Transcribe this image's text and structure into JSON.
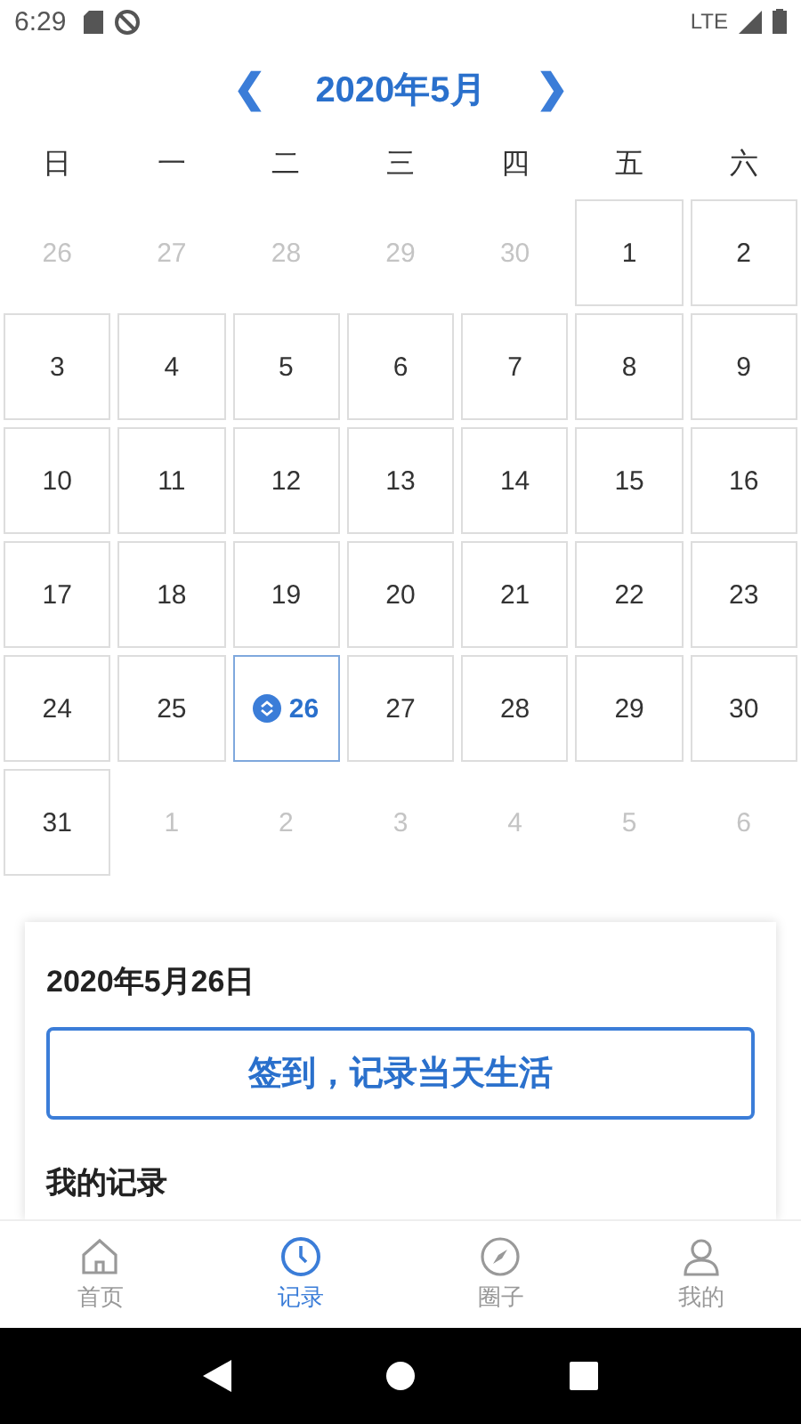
{
  "status_bar": {
    "time": "6:29",
    "network": "LTE"
  },
  "header": {
    "prev": "❮",
    "title": "2020年5月",
    "next": "❯"
  },
  "weekdays": [
    "日",
    "一",
    "二",
    "三",
    "四",
    "五",
    "六"
  ],
  "days": [
    {
      "label": "26",
      "in_month": false,
      "selected": false,
      "checked_in": false
    },
    {
      "label": "27",
      "in_month": false,
      "selected": false,
      "checked_in": false
    },
    {
      "label": "28",
      "in_month": false,
      "selected": false,
      "checked_in": false
    },
    {
      "label": "29",
      "in_month": false,
      "selected": false,
      "checked_in": false
    },
    {
      "label": "30",
      "in_month": false,
      "selected": false,
      "checked_in": false
    },
    {
      "label": "1",
      "in_month": true,
      "selected": false,
      "checked_in": false
    },
    {
      "label": "2",
      "in_month": true,
      "selected": false,
      "checked_in": false
    },
    {
      "label": "3",
      "in_month": true,
      "selected": false,
      "checked_in": false
    },
    {
      "label": "4",
      "in_month": true,
      "selected": false,
      "checked_in": false
    },
    {
      "label": "5",
      "in_month": true,
      "selected": false,
      "checked_in": false
    },
    {
      "label": "6",
      "in_month": true,
      "selected": false,
      "checked_in": false
    },
    {
      "label": "7",
      "in_month": true,
      "selected": false,
      "checked_in": false
    },
    {
      "label": "8",
      "in_month": true,
      "selected": false,
      "checked_in": false
    },
    {
      "label": "9",
      "in_month": true,
      "selected": false,
      "checked_in": false
    },
    {
      "label": "10",
      "in_month": true,
      "selected": false,
      "checked_in": false
    },
    {
      "label": "11",
      "in_month": true,
      "selected": false,
      "checked_in": false
    },
    {
      "label": "12",
      "in_month": true,
      "selected": false,
      "checked_in": false
    },
    {
      "label": "13",
      "in_month": true,
      "selected": false,
      "checked_in": false
    },
    {
      "label": "14",
      "in_month": true,
      "selected": false,
      "checked_in": false
    },
    {
      "label": "15",
      "in_month": true,
      "selected": false,
      "checked_in": false
    },
    {
      "label": "16",
      "in_month": true,
      "selected": false,
      "checked_in": false
    },
    {
      "label": "17",
      "in_month": true,
      "selected": false,
      "checked_in": false
    },
    {
      "label": "18",
      "in_month": true,
      "selected": false,
      "checked_in": false
    },
    {
      "label": "19",
      "in_month": true,
      "selected": false,
      "checked_in": false
    },
    {
      "label": "20",
      "in_month": true,
      "selected": false,
      "checked_in": false
    },
    {
      "label": "21",
      "in_month": true,
      "selected": false,
      "checked_in": false
    },
    {
      "label": "22",
      "in_month": true,
      "selected": false,
      "checked_in": false
    },
    {
      "label": "23",
      "in_month": true,
      "selected": false,
      "checked_in": false
    },
    {
      "label": "24",
      "in_month": true,
      "selected": false,
      "checked_in": false
    },
    {
      "label": "25",
      "in_month": true,
      "selected": false,
      "checked_in": false
    },
    {
      "label": "26",
      "in_month": true,
      "selected": true,
      "checked_in": true
    },
    {
      "label": "27",
      "in_month": true,
      "selected": false,
      "checked_in": false
    },
    {
      "label": "28",
      "in_month": true,
      "selected": false,
      "checked_in": false
    },
    {
      "label": "29",
      "in_month": true,
      "selected": false,
      "checked_in": false
    },
    {
      "label": "30",
      "in_month": true,
      "selected": false,
      "checked_in": false
    },
    {
      "label": "31",
      "in_month": true,
      "selected": false,
      "checked_in": false
    },
    {
      "label": "1",
      "in_month": false,
      "selected": false,
      "checked_in": false
    },
    {
      "label": "2",
      "in_month": false,
      "selected": false,
      "checked_in": false
    },
    {
      "label": "3",
      "in_month": false,
      "selected": false,
      "checked_in": false
    },
    {
      "label": "4",
      "in_month": false,
      "selected": false,
      "checked_in": false
    },
    {
      "label": "5",
      "in_month": false,
      "selected": false,
      "checked_in": false
    },
    {
      "label": "6",
      "in_month": false,
      "selected": false,
      "checked_in": false
    }
  ],
  "card": {
    "date": "2020年5月26日",
    "checkin_button": "签到，记录当天生活",
    "section_title": "我的记录"
  },
  "tabs": [
    {
      "kind": "home",
      "label": "首页",
      "selected": false
    },
    {
      "kind": "clock",
      "label": "记录",
      "selected": true
    },
    {
      "kind": "compass",
      "label": "圈子",
      "selected": false
    },
    {
      "kind": "person",
      "label": "我的",
      "selected": false
    }
  ]
}
